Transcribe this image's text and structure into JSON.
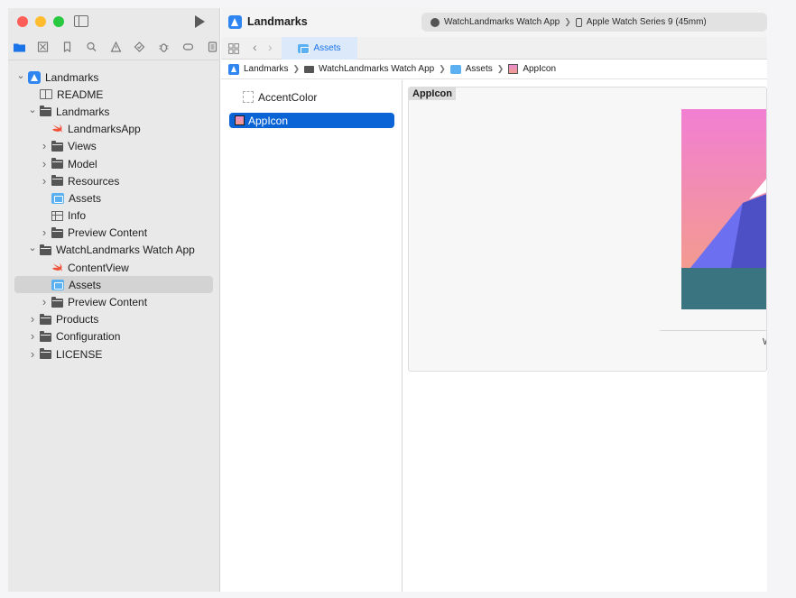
{
  "window": {
    "app_title": "Landmarks",
    "scheme": {
      "target": "WatchLandmarks Watch App",
      "device": "Apple Watch Series 9 (45mm)"
    }
  },
  "navigator_icons": [
    "folder-icon",
    "source-control-icon",
    "bookmark-icon",
    "find-icon",
    "issue-icon",
    "test-icon",
    "debug-icon",
    "breakpoint-icon",
    "report-icon"
  ],
  "sidebar": {
    "tree": [
      {
        "label": "Landmarks",
        "icon": "project-icon",
        "depth": 0,
        "disclosure": "open"
      },
      {
        "label": "README",
        "icon": "book-icon",
        "depth": 1,
        "disclosure": "none"
      },
      {
        "label": "Landmarks",
        "icon": "folder-icon",
        "depth": 1,
        "disclosure": "open"
      },
      {
        "label": "LandmarksApp",
        "icon": "swift-icon",
        "depth": 2,
        "disclosure": "none"
      },
      {
        "label": "Views",
        "icon": "folder-icon",
        "depth": 2,
        "disclosure": "closed"
      },
      {
        "label": "Model",
        "icon": "folder-icon",
        "depth": 2,
        "disclosure": "closed"
      },
      {
        "label": "Resources",
        "icon": "folder-icon",
        "depth": 2,
        "disclosure": "closed"
      },
      {
        "label": "Assets",
        "icon": "assets-icon",
        "depth": 2,
        "disclosure": "none"
      },
      {
        "label": "Info",
        "icon": "table-icon",
        "depth": 2,
        "disclosure": "none"
      },
      {
        "label": "Preview Content",
        "icon": "folder-icon",
        "depth": 2,
        "disclosure": "closed"
      },
      {
        "label": "WatchLandmarks Watch App",
        "icon": "folder-icon",
        "depth": 1,
        "disclosure": "open"
      },
      {
        "label": "ContentView",
        "icon": "swift-icon",
        "depth": 2,
        "disclosure": "none"
      },
      {
        "label": "Assets",
        "icon": "assets-icon",
        "depth": 2,
        "disclosure": "none",
        "selected": true
      },
      {
        "label": "Preview Content",
        "icon": "folder-icon",
        "depth": 2,
        "disclosure": "closed"
      },
      {
        "label": "Products",
        "icon": "folder-icon",
        "depth": 1,
        "disclosure": "closed"
      },
      {
        "label": "Configuration",
        "icon": "folder-icon",
        "depth": 1,
        "disclosure": "closed"
      },
      {
        "label": "LICENSE",
        "icon": "folder-icon",
        "depth": 1,
        "disclosure": "closed"
      }
    ]
  },
  "tab": {
    "label": "Assets"
  },
  "breadcrumb": {
    "items": [
      {
        "label": "Landmarks",
        "icon": "project-icon"
      },
      {
        "label": "WatchLandmarks Watch App",
        "icon": "folder-icon"
      },
      {
        "label": "Assets",
        "icon": "assets-icon"
      },
      {
        "label": "AppIcon",
        "icon": "app-icon-image"
      }
    ]
  },
  "asset_list": {
    "items": [
      {
        "label": "AccentColor",
        "icon": "color-swatch-icon",
        "selected": false
      },
      {
        "label": "AppIcon",
        "icon": "app-icon-image",
        "selected": true
      }
    ]
  },
  "detail": {
    "label": "AppIcon",
    "caption": "W"
  },
  "colors": {
    "accent": "#0a64d6",
    "icon_gradient_top": "#f27fd3",
    "icon_gradient_bottom": "#f3a27e",
    "icon_mountain": "#5a5fd8",
    "icon_water": "#3a7480"
  }
}
